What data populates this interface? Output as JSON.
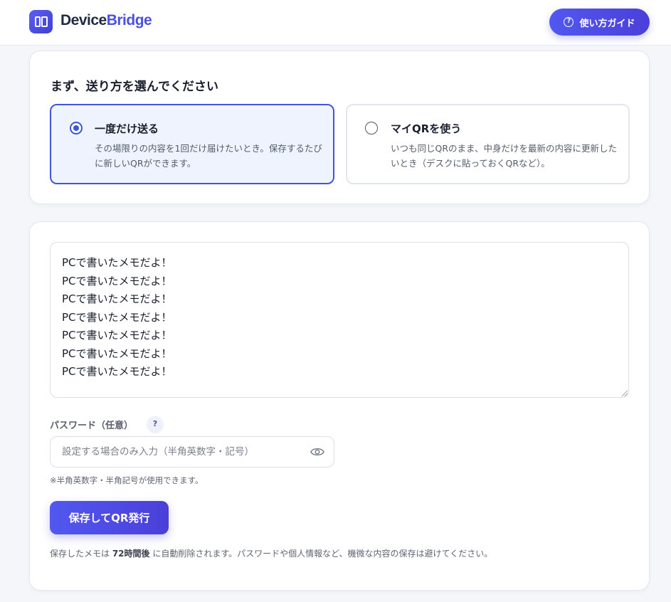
{
  "header": {
    "brand_part1": "Device",
    "brand_part2": "Bridge",
    "guide_button": "使い方ガイド"
  },
  "mode_section": {
    "title": "まず、送り方を選んでください",
    "options": [
      {
        "label": "一度だけ送る",
        "description": "その場限りの内容を1回だけ届けたいとき。保存するたびに新しいQRができます。",
        "selected": true
      },
      {
        "label": "マイQRを使う",
        "description": "いつも同じQRのまま、中身だけを最新の内容に更新したいとき（デスクに貼っておくQRなど）。",
        "selected": false
      }
    ]
  },
  "form": {
    "memo_text": "PCで書いたメモだよ！\nPCで書いたメモだよ！\nPCで書いたメモだよ！\nPCで書いたメモだよ！\nPCで書いたメモだよ！\nPCで書いたメモだよ！\nPCで書いたメモだよ！",
    "password_label": "パスワード（任意）",
    "password_help": "?",
    "password_placeholder": "設定する場合のみ入力（半角英数字・記号）",
    "password_note": "※半角英数字・半角記号が使用できます。",
    "save_button": "保存してQR発行",
    "footnote_before": "保存したメモは ",
    "footnote_bold": "72時間後",
    "footnote_after": " に自動削除されます。パスワードや個人情報など、機微な内容の保存は避けてください。"
  },
  "colors": {
    "accent": "#4a52dc",
    "selected_border": "#4456d8",
    "selected_bg": "#eef3fd"
  }
}
